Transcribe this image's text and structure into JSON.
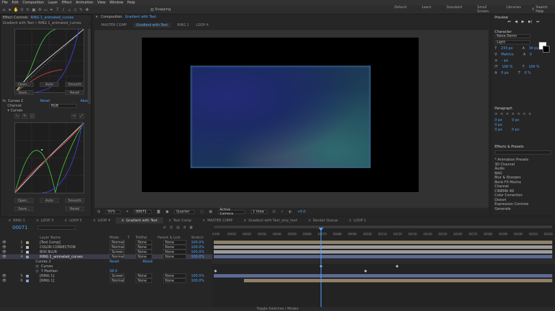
{
  "menu": [
    "File",
    "Edit",
    "Composition",
    "Layer",
    "Effect",
    "Animation",
    "View",
    "Window",
    "Help"
  ],
  "toolbar": {
    "snapping": "Snapping",
    "workspaces": [
      "Default",
      "Learn",
      "Standard",
      "Small Screen",
      "Libraries"
    ],
    "search_placeholder": "Search Help"
  },
  "effect_controls": {
    "tab_label": "Effect Controls",
    "tab_layer": "RING 1_animated_curves",
    "breadcrumb": "Gradient with Text • RING 1_animated_curves",
    "buttons1": [
      "Open...",
      "Auto",
      "Smooth",
      "Save...",
      "Reset"
    ],
    "fx_name": "Curves 2",
    "fx_reset": "Reset",
    "fx_about": "About",
    "channel_label": "Channel",
    "channel_value": "RGB",
    "curves_label": "Curves",
    "buttons2": [
      "Open...",
      "Auto",
      "Smooth",
      "Save...",
      "Reset"
    ]
  },
  "composition_panel": {
    "tab_label": "Composition",
    "tab_comp": "Gradient with Text",
    "sub_tabs": [
      "MASTER COMP",
      "Gradient with Text",
      "RING 1",
      "LOOP 4"
    ],
    "active_sub_tab": "Gradient with Text"
  },
  "viewer_bar": {
    "zoom": "50%",
    "timecode": "00071",
    "resolution": "Quarter",
    "camera": "Active Camera",
    "view": "1 View",
    "exposure": "+0.0"
  },
  "right_panel": {
    "preview_title": "Preview",
    "character_title": "Character",
    "font": "Nexa Demo",
    "font_style": "Light",
    "size": "233 px",
    "leading": "34 px",
    "tracking_metric": "Metrics",
    "tracking_value": "0",
    "stroke": "- px",
    "vscale": "100 %",
    "hscale": "100 %",
    "baseline": "0 px",
    "tsume": "0 %",
    "paragraph_title": "Paragraph",
    "para_vals": [
      "0 px",
      "0 px",
      "0 px",
      "0 px",
      "0 px"
    ],
    "effects_title": "Effects & Presets",
    "effects_search": "",
    "effects_list": [
      "* Animation Presets",
      "3D Channel",
      "Audio",
      "BAO",
      "Blur & Sharpen",
      "Boris FX Mocha",
      "Channel",
      "CINEMA 4D",
      "Color Correction",
      "Distort",
      "Expression Controls",
      "Generate"
    ]
  },
  "timeline": {
    "tabs": [
      "RING 1",
      "LOOP 3",
      "LOOP 5",
      "LOOP 4",
      "Gradient with Text",
      "Text Comp",
      "MASTER COMP",
      "Gradient with Text_only_text",
      "Render Queue",
      "LOOP 1"
    ],
    "active_tab": "Gradient with Text",
    "timecode": "00071",
    "headers": {
      "layer_name": "Layer Name",
      "mode": "Mode",
      "t": "T",
      "trkmat": "TrkMat",
      "parent": "Parent & Link",
      "stretch": "Stretch"
    },
    "ticks": [
      "0:00f",
      "00010",
      "00020",
      "00030",
      "00040",
      "00050",
      "00060",
      "00070",
      "00080",
      "00090",
      "00100",
      "00110",
      "00120",
      "00130",
      "00140",
      "00150",
      "00160",
      "00170",
      "00180",
      "00190",
      "00200",
      "00210",
      "00220"
    ],
    "layers": [
      {
        "num": "1",
        "name": "[Text Comp]",
        "mode": "Normal",
        "trk": "None",
        "parent": "None",
        "stretch": "100.0%",
        "color": "#b8a78a"
      },
      {
        "num": "2",
        "name": "COLOR CORRECTION",
        "mode": "Normal",
        "trk": "None",
        "parent": "None",
        "stretch": "100.0%",
        "color": "#c4c4c4"
      },
      {
        "num": "3",
        "name": "BOX BLUR",
        "mode": "Screen",
        "trk": "None",
        "parent": "None",
        "stretch": "100.0%",
        "color": "#c4c4c4"
      },
      {
        "num": "4",
        "name": "RING 1_animated_curves",
        "mode": "Normal",
        "trk": "None",
        "parent": "None",
        "stretch": "100.0%",
        "color": "#8fa0c8"
      }
    ],
    "sub": {
      "effect": "Curves 2",
      "reset": "Reset",
      "about": "About",
      "prop": "Curves",
      "transform": "Y Position",
      "transform_val": "58.0"
    },
    "layers2": [
      {
        "num": "5",
        "name": "[RING 1]",
        "mode": "Screen",
        "trk": "None",
        "parent": "None",
        "stretch": "100.0%",
        "color": "#8fa0c8"
      },
      {
        "num": "6",
        "name": "[RING 1]",
        "mode": "Normal",
        "trk": "None",
        "parent": "None",
        "stretch": "100.0%",
        "color": "#8fa0c8"
      }
    ],
    "footer": "Toggle Switches / Modes"
  }
}
